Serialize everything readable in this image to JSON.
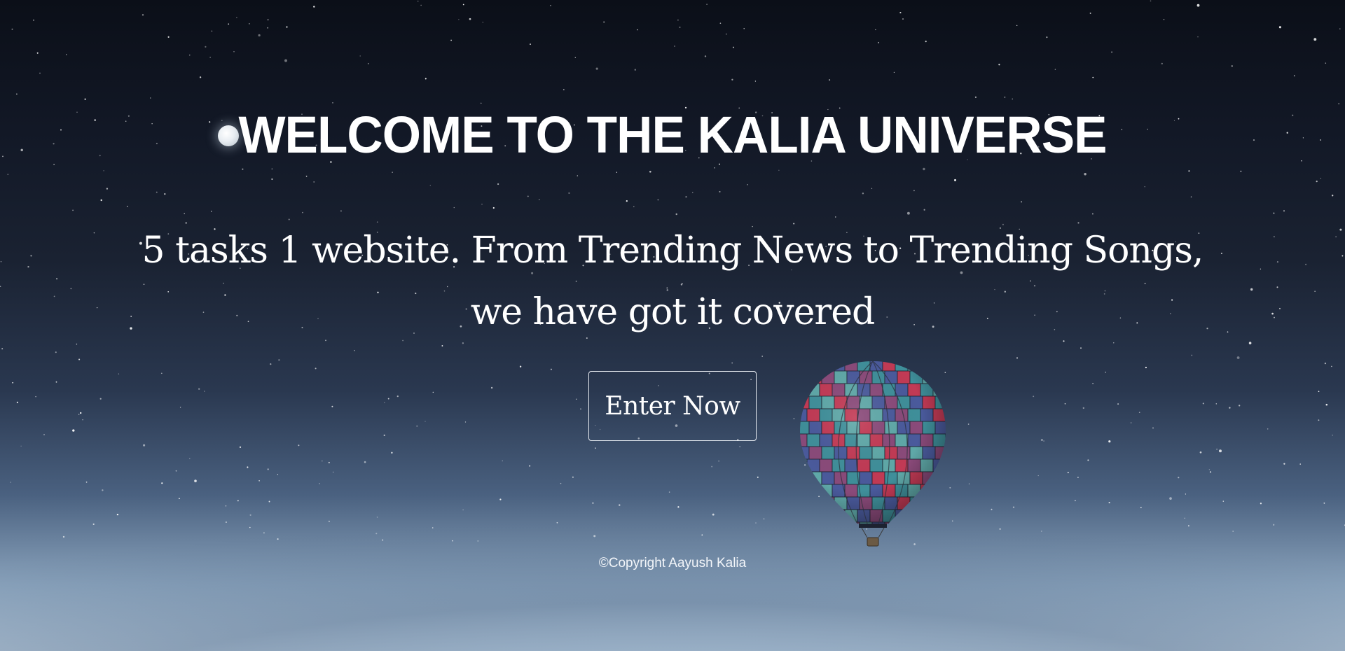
{
  "hero": {
    "title": "WELCOME TO THE KALIA UNIVERSE",
    "subtitle": "5 tasks 1 website. From Trending News to Trending Songs, we have got it covered",
    "cta_label": "Enter Now"
  },
  "footer": {
    "copyright": "©Copyright Aayush Kalia"
  },
  "icons": {
    "moon": "moon-icon",
    "balloon": "hot-air-balloon-icon"
  },
  "colors": {
    "text": "#ffffff",
    "sky_top": "#0b0f18",
    "horizon": "#b3c5d6",
    "button_border": "#e8ecf2",
    "balloon_red": "#c23a55",
    "balloon_teal": "#3f8f9a",
    "balloon_blue": "#4a5a9c"
  }
}
